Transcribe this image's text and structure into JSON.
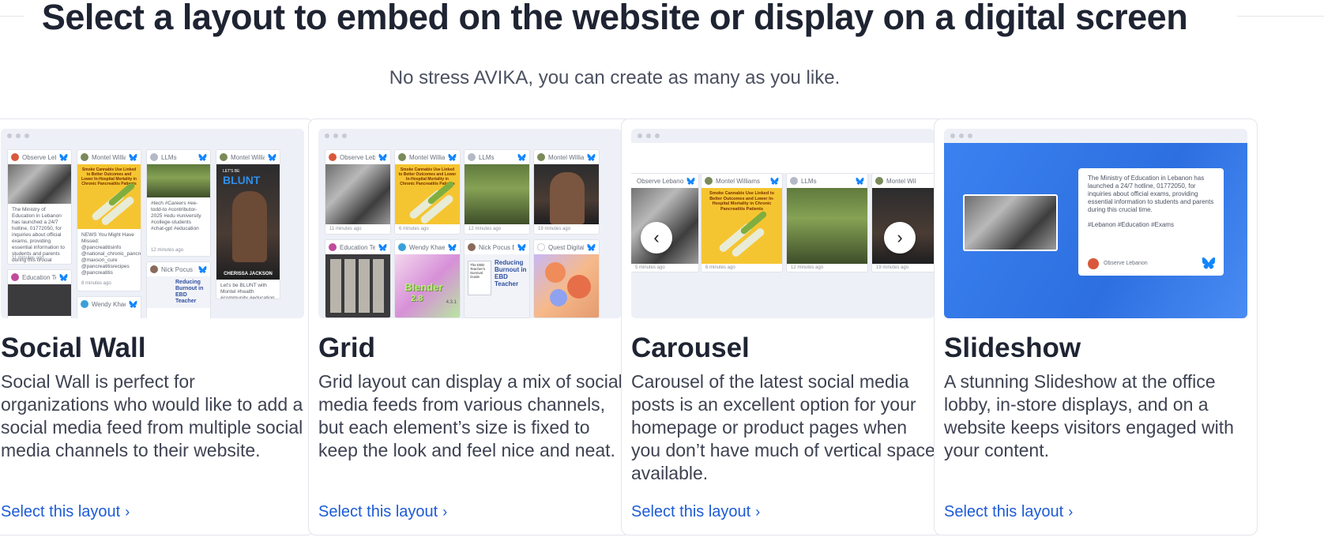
{
  "header": {
    "title": "Select a layout to embed on the website or display on a digital screen",
    "subtitle": "No stress AVIKA, you can create as many as you like."
  },
  "colors": {
    "link": "#1c5bd6",
    "title": "#1f2433",
    "slideshow_bg": "#3b82f0",
    "bluesky": "#1185fe"
  },
  "icons": {
    "link_chevron": "›",
    "arrow_left": "‹",
    "arrow_right": "›"
  },
  "cards": [
    {
      "title": "Social Wall",
      "description": "Social Wall is perfect for organizations who would like to add a social media feed from multiple social media channels to their website.",
      "link": "Select this layout"
    },
    {
      "title": "Grid",
      "description": "Grid layout can display a mix of social media feeds from various channels, but each element’s size is fixed to keep the look and feel nice and neat.",
      "link": "Select this layout"
    },
    {
      "title": "Carousel",
      "description": "Carousel of the latest social media posts is an excellent option for your homepage or product pages when you don’t have much of vertical space available.",
      "link": "Select this layout"
    },
    {
      "title": "Slideshow",
      "description": "A stunning Slideshow at the office lobby, in-store displays, and on a website keeps visitors engaged with your content.",
      "link": "Select this layout"
    }
  ],
  "previews": {
    "wall": {
      "names": [
        "Observe Leba",
        "Montel Willian",
        "LLMs",
        "Montel Willian",
        "Education Tec",
        "Nick Pocus E",
        "Wendy Khaev"
      ],
      "text1": "The Ministry of Education in Lebanon has launched a 24/7 hotline, 01772050, for inquiries about official exams, providing essential information to students and parents during this crucial",
      "text2": "NEWS You Might Have Missed: @pancreatitisinfo @national_chronic_pancre... @maxson_cure @pancreatitisrecipes @pancreatitis",
      "text3": "#tech #Careers #ee-todd-to #contributor-2025 #edu #university #college-students #chat-gpt #education",
      "text4": "Let's be BLUNT with Montel #health #community #education #use",
      "time1": "11 minutes ago",
      "time2": "8 minutes ago",
      "time3": "12 minutes ago",
      "poster_text": "Smoke Cannabis Use Linked to Better Outcomes and Lower In-Hospital Mortality in Chronic Pancreatitis Patients",
      "blunt": "BLUNT",
      "caption": "CHERISSA JACKSON",
      "blunt_pre": "LET'S BE"
    },
    "grid": {
      "names": [
        "Observe Leba",
        "Montel Willian",
        "LLMs",
        "Montel Willian",
        "Education Tec",
        "Wendy Khaev",
        "Nick Pocus E",
        "Quest Digital"
      ],
      "times": [
        "11 minutes ago",
        "6 minutes ago",
        "12 minutes ago",
        "19 minutes ago"
      ],
      "poster_text": "Smoke Cannabis Use Linked to Better Outcomes and Lower In-Hospital Mortality in Chronic Pancreatitis Patients",
      "blender": "Blender",
      "blender_num": "2.8",
      "blender_ver": "4.3.1",
      "burnout": "Reducing Burnout in EBD Teacher",
      "ebd_small": "The EBD Teacher's Survival Guide"
    },
    "carousel": {
      "names": [
        "Observe Lebanon",
        "Montel Williams",
        "LLMs",
        "Montel Wil"
      ],
      "times": [
        "5 minutes ago",
        "6 minutes ago",
        "12 minutes ago",
        "19 minutes ago"
      ],
      "poster_text": "Smoke Cannabis Use Linked to Better Outcomes and Lower In-Hospital Mortality in Chronic Pancreatitis Patients"
    },
    "slideshow": {
      "text": "The Ministry of Education in Lebanon has launched a 24/7 hotline, 01772050, for inquiries about official exams, providing essential information to students and parents during this crucial time.",
      "tags": "#Lebanon #Education #Exams",
      "author": "Observe Lebanon"
    }
  }
}
